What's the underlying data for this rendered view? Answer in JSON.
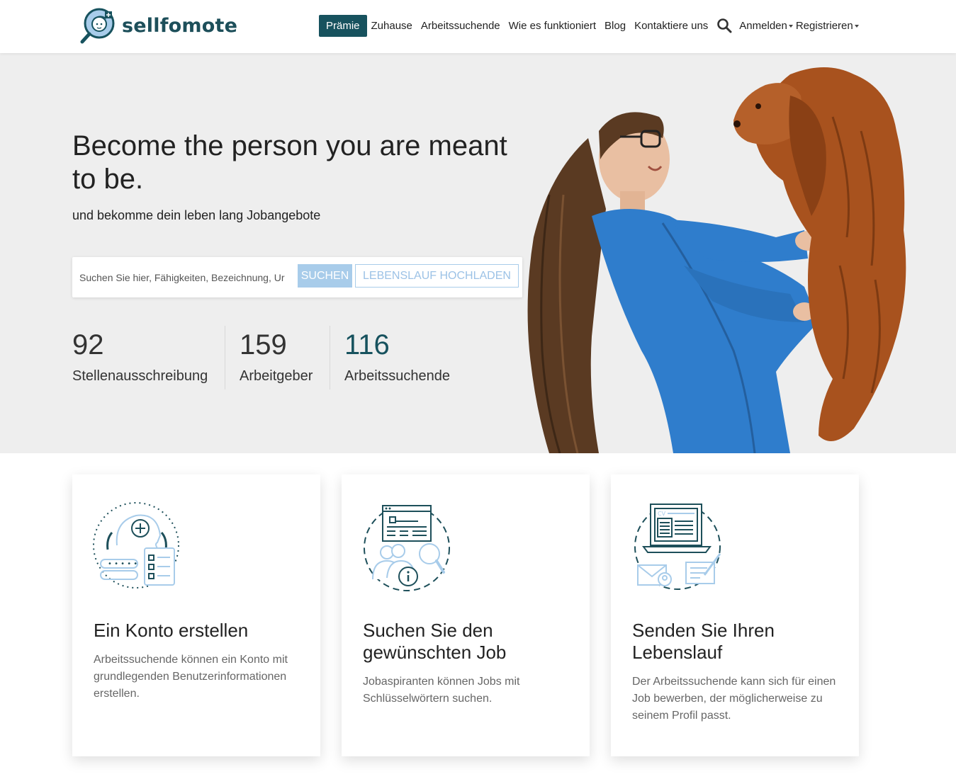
{
  "brand": {
    "name": "sellfomote"
  },
  "nav": {
    "premium": "Prämie",
    "home": "Zuhause",
    "jobseekers": "Arbeitssuchende",
    "how": "Wie es funktioniert",
    "blog": "Blog",
    "contact": "Kontaktiere uns",
    "login": "Anmelden",
    "register": "Registrieren"
  },
  "hero": {
    "title": "Become the person you are meant to be.",
    "subtitle": "und bekomme dein leben lang Jobangebote",
    "search_placeholder": "Suchen Sie hier, Fähigkeiten, Bezeichnung, Ur",
    "search_button": "SUCHEN",
    "upload_button": "LEBENSLAUF HOCHLADEN"
  },
  "stats": [
    {
      "value": "92",
      "label": "Stellenausschreibung"
    },
    {
      "value": "159",
      "label": "Arbeitgeber"
    },
    {
      "value": "116",
      "label": "Arbeitssuchende"
    }
  ],
  "cards": [
    {
      "title": "Ein Konto erstellen",
      "text": "Arbeitssuchende können ein Konto mit grundlegenden Benutzerinformationen erstellen."
    },
    {
      "title": "Suchen Sie den gewünschten Job",
      "text": "Jobaspiranten können Jobs mit Schlüsselwörtern suchen."
    },
    {
      "title": "Senden Sie Ihren Lebenslauf",
      "text": "Der Arbeitssuchende kann sich für einen Job bewerben, der möglicherweise zu seinem Profil passt."
    }
  ],
  "colors": {
    "brand": "#17525e",
    "accent_light": "#a8ccea",
    "hero_bg": "#eeeeee"
  },
  "icons": [
    "logo-icon",
    "search-icon",
    "account-icon",
    "job-search-icon",
    "resume-icon"
  ]
}
